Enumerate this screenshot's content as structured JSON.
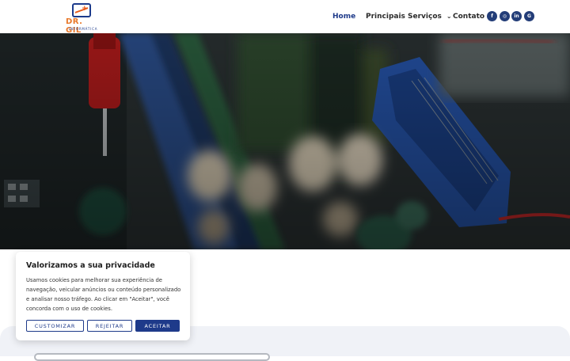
{
  "brand": {
    "name": "DR. GIL",
    "subtitle": "INFORMÁTICA",
    "primary_color": "#1e3a8a",
    "accent_color": "#e8782a"
  },
  "nav": {
    "items": [
      {
        "label": "Home",
        "active": true
      },
      {
        "label": "Principais Serviços",
        "has_dropdown": true
      },
      {
        "label": "Contato"
      }
    ],
    "social": [
      {
        "icon": "facebook-icon",
        "glyph": "f"
      },
      {
        "icon": "instagram-icon",
        "glyph": "◎"
      },
      {
        "icon": "linkedin-icon",
        "glyph": "in"
      },
      {
        "icon": "google-icon",
        "glyph": "G"
      }
    ]
  },
  "hero": {
    "image": "circuit-board-photo"
  },
  "cookie": {
    "title": "Valorizamos a sua privacidade",
    "text": "Usamos cookies para melhorar sua experiência de navegação, veicular anúncios ou conteúdo personalizado e analisar nosso tráfego. Ao clicar em \"Aceitar\", você concorda com o uso de cookies.",
    "buttons": {
      "customize": "CUSTOMIZAR",
      "reject": "REJEITAR",
      "accept": "ACEITAR"
    }
  }
}
